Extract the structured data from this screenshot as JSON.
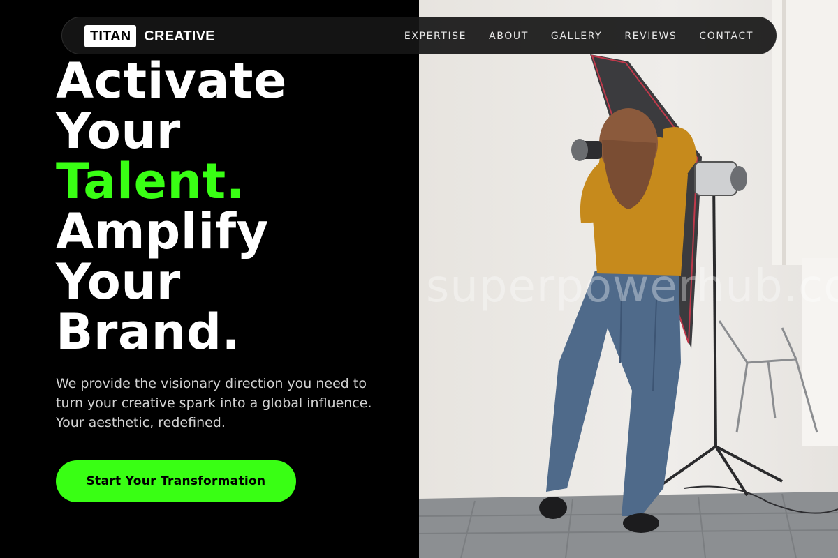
{
  "brand": {
    "logo_box": "TITAN",
    "logo_text": "CREATIVE"
  },
  "nav": {
    "items": [
      {
        "label": "EXPERTISE"
      },
      {
        "label": "ABOUT"
      },
      {
        "label": "GALLERY"
      },
      {
        "label": "REVIEWS"
      },
      {
        "label": "CONTACT"
      }
    ]
  },
  "hero": {
    "headline": {
      "line1": "Activate",
      "line2": "Your",
      "line3": "Talent.",
      "line4": "Amplify",
      "line5": "Your",
      "line6": "Brand."
    },
    "lead": "We provide the visionary direction you need to turn your creative spark into a global influence. Your aesthetic, redefined.",
    "cta_label": "Start Your Transformation"
  },
  "photo": {
    "watermark": "superpowerhub.co"
  },
  "colors": {
    "accent": "#39ff14",
    "background": "#000000",
    "text": "#ffffff"
  }
}
